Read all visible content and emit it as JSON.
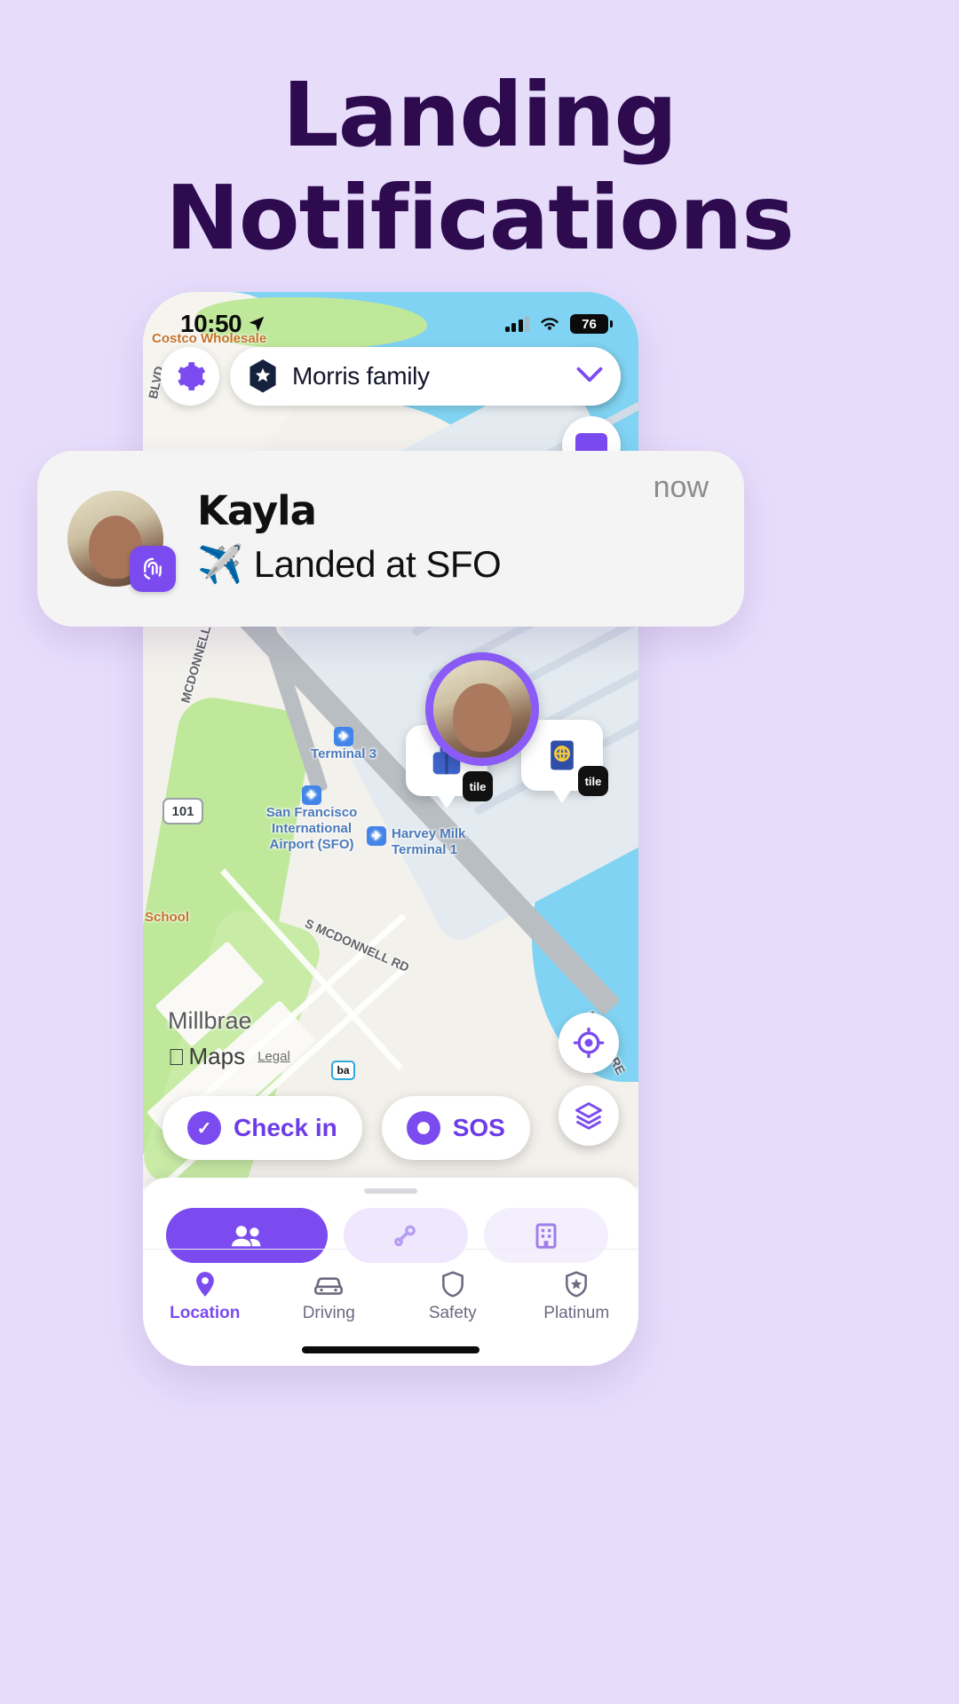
{
  "headline": {
    "line1": "Landing",
    "line2": "Notifications"
  },
  "colors": {
    "page_bg": "#E7DDFB",
    "headline": "#2E0B4F",
    "brand_purple": "#7B4BF0",
    "map_water": "#80D3F2",
    "map_land": "#F3F1EC",
    "notification_bg": "#F4F4F4"
  },
  "status_bar": {
    "time": "10:50",
    "location_icon": "location-arrow-icon",
    "signal_icon": "cellular-signal-icon",
    "wifi_icon": "wifi-icon",
    "battery_level": "76"
  },
  "map_header": {
    "settings_icon": "gear-icon",
    "circle_badge_icon": "hexagon-star-icon",
    "circle_name": "Morris family",
    "chevron_icon": "chevron-down-icon",
    "messages_icon": "envelope-icon",
    "secondary_icon": "chat-icon"
  },
  "map": {
    "attribution": "Maps",
    "attribution_legal": "Legal",
    "city_label": "Millbrae",
    "highway_shield": "101",
    "labels": [
      {
        "name": "terminal-3-label",
        "text": "Terminal 3",
        "icon": "airport-terminal-icon"
      },
      {
        "name": "sfo-label",
        "text": "San Francisco\nInternational\nAirport (SFO)",
        "icon": "airport-icon"
      },
      {
        "name": "harvey-milk-label",
        "text": "Harvey Milk\nTerminal 1",
        "icon": "airport-terminal-icon"
      }
    ],
    "roads": [
      {
        "name": "s-mcdonnell-rd-lower",
        "text": "S MCDONNELL RD"
      },
      {
        "name": "mcdonnell-rd-upper",
        "text": "MCDONNELL RD"
      },
      {
        "name": "bayshore-fwy",
        "text": "BAYSHORE"
      },
      {
        "name": "blvd-left",
        "text": "BLVD"
      }
    ],
    "pois": [
      {
        "name": "costco-wholesale-poi",
        "text": "Costco Wholesale"
      },
      {
        "name": "school-poi",
        "text": "School"
      },
      {
        "name": "bart-station-icon",
        "text": "ba"
      }
    ],
    "markers": [
      {
        "name": "kayla-location-marker",
        "label": ""
      },
      {
        "name": "tile-luggage-marker",
        "badge": "tile",
        "icon": "suitcase-icon"
      },
      {
        "name": "tile-passport-marker",
        "badge": "tile",
        "icon": "passport-icon"
      }
    ],
    "fabs": [
      {
        "name": "recenter-button",
        "icon": "crosshair-icon"
      },
      {
        "name": "map-layers-button",
        "icon": "layers-icon"
      }
    ],
    "actions": [
      {
        "name": "check-in-button",
        "label": "Check in",
        "icon": "check-circle-icon"
      },
      {
        "name": "sos-button",
        "label": "SOS",
        "icon": "sos-icon"
      }
    ]
  },
  "sheet": {
    "pills": [
      {
        "name": "people-pill",
        "label": "",
        "icon": "people-icon",
        "active": true
      },
      {
        "name": "pets-pill",
        "label": "",
        "icon": "pet-bone-icon",
        "active": false
      },
      {
        "name": "places-pill",
        "label": "",
        "icon": "building-icon",
        "active": false
      }
    ]
  },
  "tab_bar": [
    {
      "name": "tab-location",
      "label": "Location",
      "icon": "map-pin-icon",
      "active": true
    },
    {
      "name": "tab-driving",
      "label": "Driving",
      "icon": "car-icon",
      "active": false
    },
    {
      "name": "tab-safety",
      "label": "Safety",
      "icon": "shield-icon",
      "active": false
    },
    {
      "name": "tab-platinum",
      "label": "Platinum",
      "icon": "star-shield-icon",
      "active": false
    }
  ],
  "notification": {
    "sender": "Kayla",
    "message": "Landed at SFO",
    "emoji": "✈️",
    "time": "now",
    "app_icon": "life360-fingerprint-icon",
    "avatar": "kayla-avatar"
  }
}
